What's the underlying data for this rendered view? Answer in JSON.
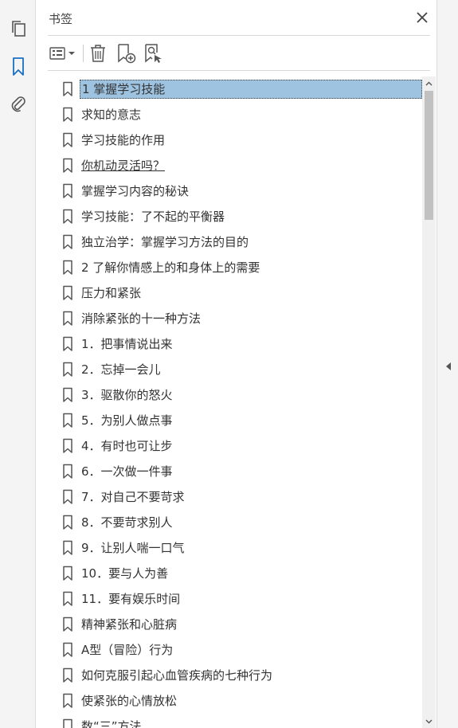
{
  "panel": {
    "title": "书签"
  },
  "left_rail": {
    "items": [
      {
        "icon": "pages-icon",
        "active": false
      },
      {
        "icon": "bookmark-icon",
        "active": true
      },
      {
        "icon": "attachment-icon",
        "active": false
      }
    ]
  },
  "toolbar": {
    "buttons": [
      {
        "icon": "options-menu-icon"
      },
      {
        "icon": "delete-icon"
      },
      {
        "icon": "new-bookmark-icon"
      },
      {
        "icon": "find-bookmark-icon"
      }
    ]
  },
  "colors": {
    "accent": "#1a6fc4",
    "selection": "#9dc3e0",
    "scroll_thumb": "#c1c1c1"
  },
  "bookmarks": [
    {
      "label": "1 掌握学习技能",
      "selected": true
    },
    {
      "label": "求知的意志"
    },
    {
      "label": "学习技能的作用"
    },
    {
      "label": "你机动灵活吗？",
      "underline": true
    },
    {
      "label": "掌握学习内容的秘诀"
    },
    {
      "label": "学习技能：了不起的平衡器"
    },
    {
      "label": "独立治学：掌握学习方法的目的"
    },
    {
      "label": "2 了解你情感上的和身体上的需要"
    },
    {
      "label": "压力和紧张"
    },
    {
      "label": "消除紧张的十一种方法"
    },
    {
      "label": "1．把事情说出来"
    },
    {
      "label": "2．忘掉一会儿"
    },
    {
      "label": "3．驱散你的怒火"
    },
    {
      "label": "5．为别人做点事"
    },
    {
      "label": "4．有时也可让步"
    },
    {
      "label": "6．一次做一件事"
    },
    {
      "label": "7．对自己不要苛求"
    },
    {
      "label": "8．不要苛求别人"
    },
    {
      "label": "9．让别人喘一口气"
    },
    {
      "label": "10．要与人为善"
    },
    {
      "label": "11．要有娱乐时间"
    },
    {
      "label": "精神紧张和心脏病"
    },
    {
      "label": "A型（冒险）行为"
    },
    {
      "label": "如何克服引起心血管疾病的七种行为"
    },
    {
      "label": "使紧张的心情放松"
    },
    {
      "label": "数“三”方法"
    }
  ]
}
